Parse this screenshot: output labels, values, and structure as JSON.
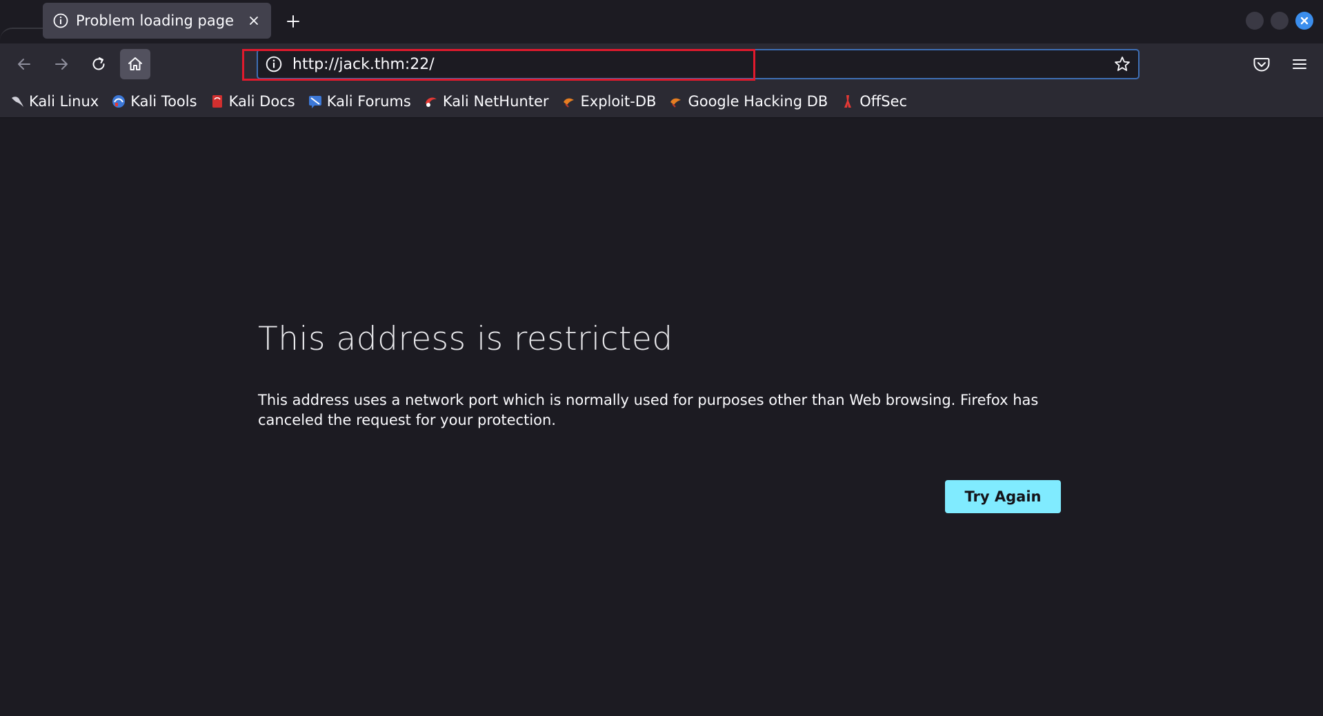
{
  "tab": {
    "title": "Problem loading page",
    "icon": "info-icon"
  },
  "toolbar": {
    "url": "http://jack.thm:22/"
  },
  "bookmarks": [
    {
      "label": "Kali Linux",
      "icon": "kali-dragon-icon",
      "color": "#cccccc"
    },
    {
      "label": "Kali Tools",
      "icon": "kali-tools-icon",
      "color": "#3c78d8"
    },
    {
      "label": "Kali Docs",
      "icon": "kali-docs-icon",
      "color": "#d33"
    },
    {
      "label": "Kali Forums",
      "icon": "kali-forums-icon",
      "color": "#3c78d8"
    },
    {
      "label": "Kali NetHunter",
      "icon": "kali-nethunter-icon",
      "color": "#e53935"
    },
    {
      "label": "Exploit-DB",
      "icon": "exploit-db-icon",
      "color": "#e67e22"
    },
    {
      "label": "Google Hacking DB",
      "icon": "ghdb-icon",
      "color": "#e67e22"
    },
    {
      "label": "OffSec",
      "icon": "offsec-icon",
      "color": "#e53935"
    }
  ],
  "error": {
    "title": "This address is restricted",
    "description": "This address uses a network port which is normally used for purposes other than Web browsing. Firefox has canceled the request for your protection.",
    "button_label": "Try Again"
  },
  "colors": {
    "accent": "#80ebff",
    "highlight_box": "#e11a2d",
    "urlbar_focus": "#3e6fb5"
  }
}
